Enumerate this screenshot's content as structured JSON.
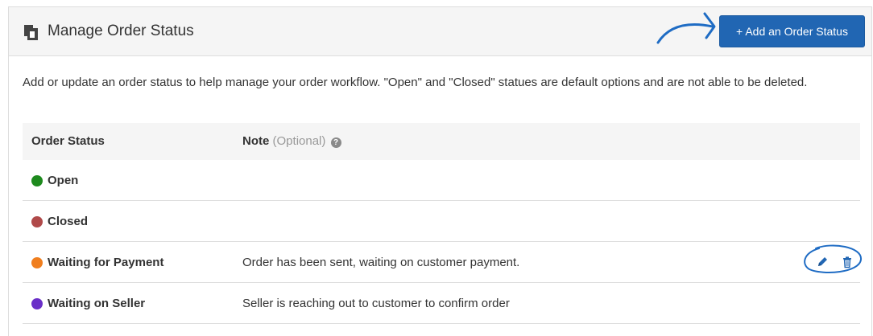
{
  "header": {
    "title": "Manage Order Status",
    "title_icon": "clipboard-copy-icon",
    "add_button_label": "+ Add an Order Status"
  },
  "description": "Add or update an order status to help manage your order workflow. \"Open\" and \"Closed\" statues are default options and are not able to be deleted.",
  "table": {
    "columns": {
      "status": "Order Status",
      "note": "Note",
      "note_optional": "(Optional)",
      "help_glyph": "?"
    },
    "rows": [
      {
        "status": "Open",
        "color": "#1e8a1e",
        "note": ""
      },
      {
        "status": "Closed",
        "color": "#b04a4a",
        "note": ""
      },
      {
        "status": "Waiting for Payment",
        "color": "#f07e1e",
        "note": "Order has been sent, waiting on customer payment."
      },
      {
        "status": "Waiting on Seller",
        "color": "#6a2fc8",
        "note": "Seller is reaching out to customer to confirm order"
      }
    ]
  },
  "colors": {
    "accent": "#2166b3",
    "annotation": "#1f6cc4"
  }
}
